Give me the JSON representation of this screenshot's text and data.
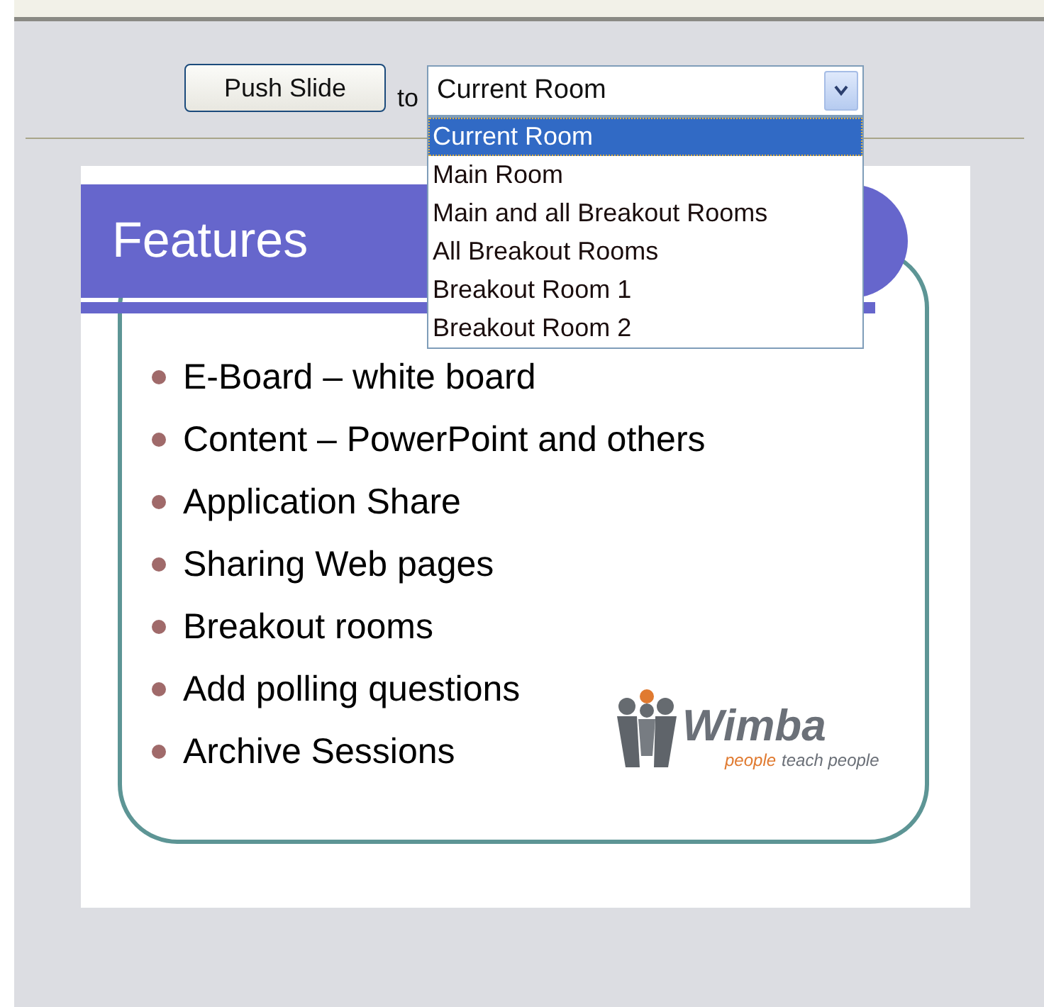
{
  "toolbar": {
    "push_button": "Push Slide",
    "to_label": "to",
    "room_select": {
      "value": "Current Room",
      "expanded": true,
      "options": [
        {
          "label": "Current Room",
          "selected": true
        },
        {
          "label": "Main Room",
          "selected": false
        },
        {
          "label": "Main and all Breakout Rooms",
          "selected": false
        },
        {
          "label": "All Breakout Rooms",
          "selected": false
        },
        {
          "label": "Breakout Room 1",
          "selected": false
        },
        {
          "label": "Breakout Room 2",
          "selected": false
        }
      ]
    }
  },
  "slide": {
    "title": "Features",
    "bullets": [
      "E-Board – white board",
      "Content – PowerPoint and others",
      "Application Share",
      "Sharing Web pages",
      "Breakout rooms",
      "Add polling questions",
      "Archive Sessions"
    ],
    "logo": {
      "wordmark": "Wimba",
      "tagline_accent": "people",
      "tagline_rest": "teach people"
    }
  }
}
